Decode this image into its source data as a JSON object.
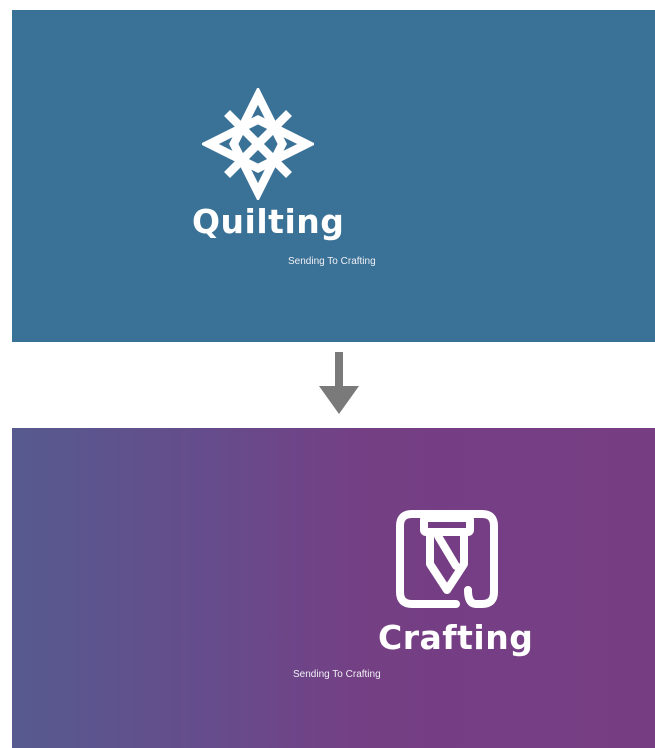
{
  "top_panel": {
    "brand_name": "Quilting",
    "caption": "Sending To Crafting",
    "background_color": "#3a7196",
    "logo_icon": "quilt-star-icon"
  },
  "arrow": {
    "icon": "arrow-down-icon",
    "color": "#7a7a7a"
  },
  "bottom_panel": {
    "brand_name": "Crafting",
    "caption": "Sending To Crafting",
    "background_gradient": [
      "#565a8f",
      "#763d83"
    ],
    "logo_icon": "crafting-tool-icon"
  }
}
